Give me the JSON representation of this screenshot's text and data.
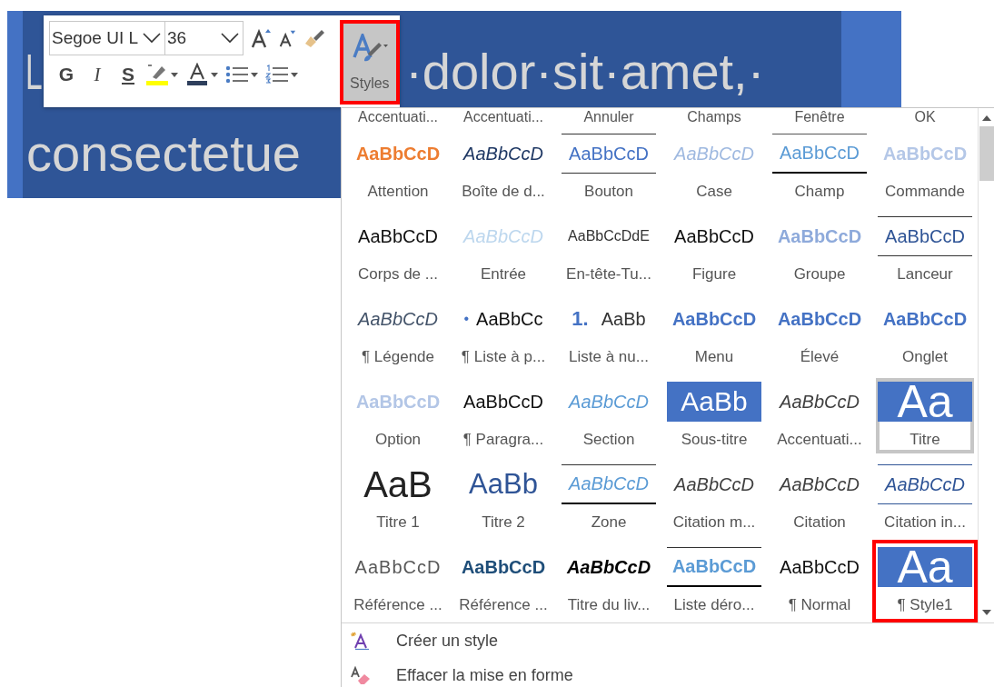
{
  "document": {
    "lines": [
      {
        "segments": [
          "L",
          "·dolor·sit·amet,·"
        ]
      },
      {
        "segments": [
          "consectetue"
        ]
      }
    ]
  },
  "toolbar": {
    "font_name": "Segoe UI L",
    "font_size": "36",
    "format_buttons": [
      "G",
      "I",
      "S"
    ],
    "styles_button": {
      "label": "Styles",
      "marked": true
    }
  },
  "styles_gallery": {
    "partial_row": [
      "Accentuati...",
      "Accentuati...",
      "Annuler",
      "Champs",
      "Fenêtre",
      "OK"
    ],
    "items": [
      {
        "name": "Attention",
        "sample": "AaBbCcD",
        "kind": "orange-bold",
        "selected": false,
        "marked": false
      },
      {
        "name": "Boîte de d...",
        "sample": "AaBbCcD",
        "kind": "navy-italic",
        "selected": false,
        "marked": false
      },
      {
        "name": "Bouton",
        "sample": "AaBbCcD",
        "kind": "blue-ruled",
        "selected": false,
        "marked": false
      },
      {
        "name": "Case",
        "sample": "AaBbCcD",
        "kind": "pale-italic",
        "selected": false,
        "marked": false
      },
      {
        "name": "Champ",
        "sample": "AaBbCcD",
        "kind": "sky-field",
        "selected": false,
        "marked": false
      },
      {
        "name": "Commande",
        "sample": "AaBbCcD",
        "kind": "lavender-bold",
        "selected": false,
        "marked": false
      },
      {
        "name": "Corps de ...",
        "sample": "AaBbCcD",
        "kind": "plain",
        "selected": false,
        "marked": false
      },
      {
        "name": "Entrée",
        "sample": "AaBbCcD",
        "kind": "ice-italic",
        "selected": false,
        "marked": false
      },
      {
        "name": "En-tête-Tu...",
        "sample": "AaBbCcDdE",
        "kind": "small-dark",
        "selected": false,
        "marked": false
      },
      {
        "name": "Figure",
        "sample": "AaBbCcD",
        "kind": "plain",
        "selected": false,
        "marked": false
      },
      {
        "name": "Groupe",
        "sample": "AaBbCcD",
        "kind": "steel-bold",
        "selected": false,
        "marked": false
      },
      {
        "name": "Lanceur",
        "sample": "AaBbCcD",
        "kind": "navy-ruled",
        "selected": false,
        "marked": false
      },
      {
        "name": "¶ Légende",
        "sample": "AaBbCcD",
        "kind": "slate-italic",
        "selected": false,
        "marked": false
      },
      {
        "name": "¶ Liste à p...",
        "marker": "•",
        "sample": "AaBbCc",
        "kind": "plain",
        "selected": false,
        "marked": false
      },
      {
        "name": "Liste à nu...",
        "marker": "1.",
        "sample": "AaBb",
        "kind": "numbered",
        "selected": false,
        "marked": false
      },
      {
        "name": "Menu",
        "sample": "AaBbCcD",
        "kind": "blue-bold",
        "selected": false,
        "marked": false
      },
      {
        "name": "Élevé",
        "sample": "AaBbCcD",
        "kind": "blue-bold",
        "selected": false,
        "marked": false
      },
      {
        "name": "Onglet",
        "sample": "AaBbCcD",
        "kind": "blue-bold",
        "selected": false,
        "marked": false
      },
      {
        "name": "Option",
        "sample": "AaBbCcD",
        "kind": "mist-bold",
        "selected": false,
        "marked": false
      },
      {
        "name": "¶ Paragra...",
        "sample": "AaBbCcD",
        "kind": "plain",
        "selected": false,
        "marked": false
      },
      {
        "name": "Section",
        "sample": "AaBbCcD",
        "kind": "sky-italic",
        "selected": false,
        "marked": false
      },
      {
        "name": "Sous-titre",
        "sample": "AaBb",
        "kind": "block-medium",
        "selected": false,
        "marked": false
      },
      {
        "name": "Accentuati...",
        "sample": "AaBbCcD",
        "kind": "gray-italic",
        "selected": false,
        "marked": false
      },
      {
        "name": "Titre",
        "sample": "Aa",
        "kind": "block-large",
        "selected": true,
        "marked": false
      },
      {
        "name": "Titre 1",
        "sample": "AaB",
        "kind": "thin-huge",
        "selected": false,
        "marked": false
      },
      {
        "name": "Titre 2",
        "sample": "AaBb",
        "kind": "thin-large-blue",
        "selected": false,
        "marked": false
      },
      {
        "name": "Zone",
        "sample": "AaBbCcD",
        "kind": "sky-italic-ruled",
        "selected": false,
        "marked": false
      },
      {
        "name": "Citation m...",
        "sample": "AaBbCcD",
        "kind": "gray-italic",
        "selected": false,
        "marked": false
      },
      {
        "name": "Citation",
        "sample": "AaBbCcD",
        "kind": "gray-italic",
        "selected": false,
        "marked": false
      },
      {
        "name": "Citation in...",
        "sample": "AaBbCcD",
        "kind": "navy-italic-ruled",
        "selected": false,
        "marked": false
      },
      {
        "name": "Référence ...",
        "sample": "AaBbCcD",
        "kind": "gray-caps",
        "selected": false,
        "marked": false
      },
      {
        "name": "Référence ...",
        "sample": "AaBbCcD",
        "kind": "navy-caps",
        "selected": false,
        "marked": false
      },
      {
        "name": "Titre du liv...",
        "sample": "AaBbCcD",
        "kind": "black-bold-italic",
        "selected": false,
        "marked": false
      },
      {
        "name": "Liste déro...",
        "sample": "AaBbCcD",
        "kind": "sky-bold-ruled",
        "selected": false,
        "marked": false
      },
      {
        "name": "¶ Normal",
        "sample": "AaBbCcD",
        "kind": "plain",
        "selected": false,
        "marked": false
      },
      {
        "name": "¶ Style1",
        "sample": "Aa",
        "kind": "block-large",
        "selected": false,
        "marked": true
      }
    ]
  },
  "menu_items": [
    {
      "label": "Créer un style",
      "kind": "create"
    },
    {
      "label": "Effacer la mise en forme",
      "kind": "clear"
    }
  ]
}
